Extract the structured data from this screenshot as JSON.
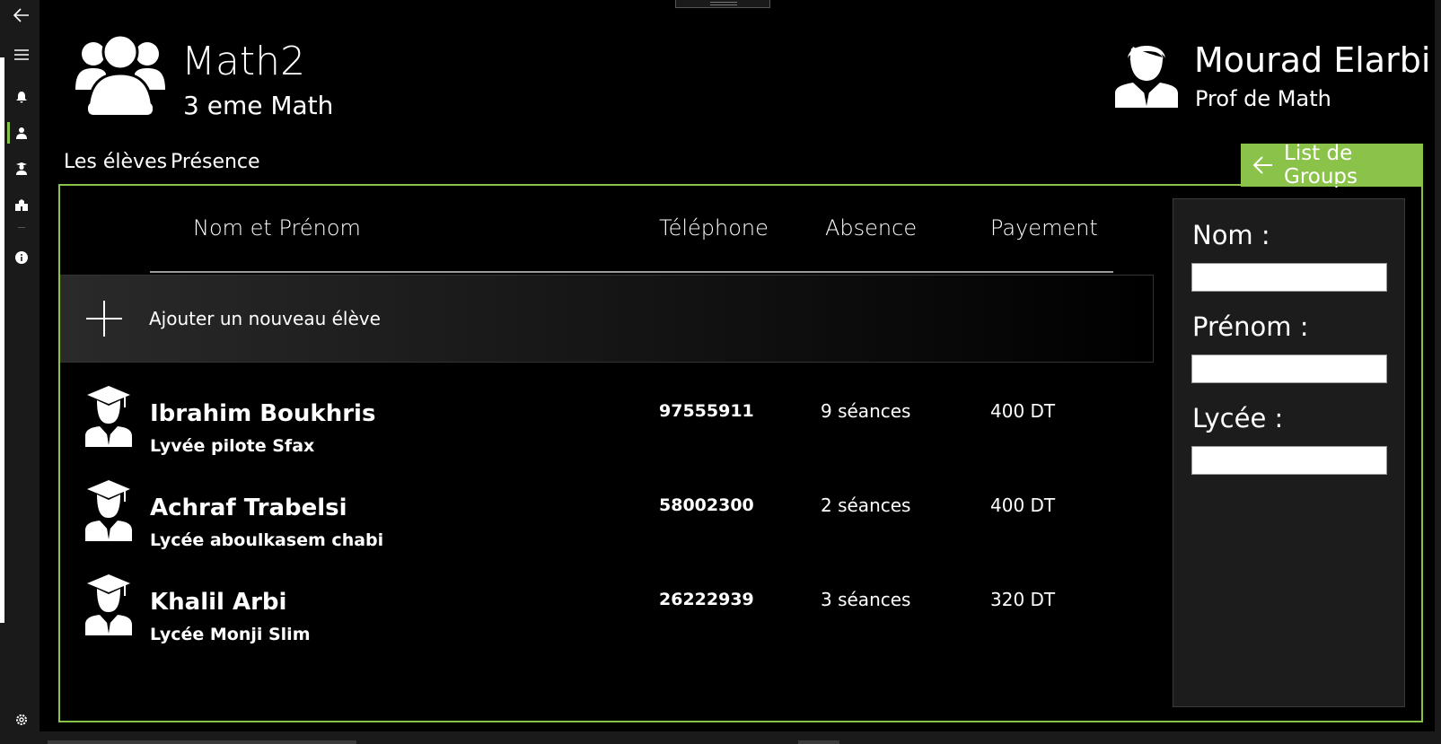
{
  "rail": {
    "items": [
      "back-icon",
      "menu-icon",
      "bell-icon",
      "teacher-icon",
      "student-icon",
      "school-icon",
      "info-icon",
      "settings-icon"
    ]
  },
  "header": {
    "group_title": "Math2",
    "group_subtitle": "3 eme Math",
    "teacher_name": "Mourad Elarbi",
    "teacher_role": "Prof de Math"
  },
  "tabs": [
    {
      "label": "Les élèves"
    },
    {
      "label": "Présence"
    }
  ],
  "back_button": {
    "label": "List de Groups"
  },
  "table": {
    "columns": {
      "name": "Nom et Prénom",
      "phone": "Téléphone",
      "absence": "Absence",
      "payment": "Payement"
    },
    "add_label": "Ajouter un nouveau élève",
    "students": [
      {
        "name": "Ibrahim Boukhris",
        "school": "Lyvée pilote Sfax",
        "phone": "97555911",
        "absence": "9 séances",
        "payment": "400 DT"
      },
      {
        "name": "Achraf Trabelsi",
        "school": "Lycée aboulkasem chabi",
        "phone": "58002300",
        "absence": "2 séances",
        "payment": "400 DT"
      },
      {
        "name": "Khalil Arbi",
        "school": "Lycée Monji Slim",
        "phone": "26222939",
        "absence": "3 séances",
        "payment": "320 DT"
      }
    ]
  },
  "form": {
    "nom_label": "Nom :",
    "nom_value": "",
    "prenom_label": "Prénom :",
    "prenom_value": "",
    "lycee_label": "Lycée :",
    "lycee_value": ""
  },
  "colors": {
    "accent": "#8bc34a",
    "background": "#000000",
    "rail": "#1a1a1a"
  }
}
